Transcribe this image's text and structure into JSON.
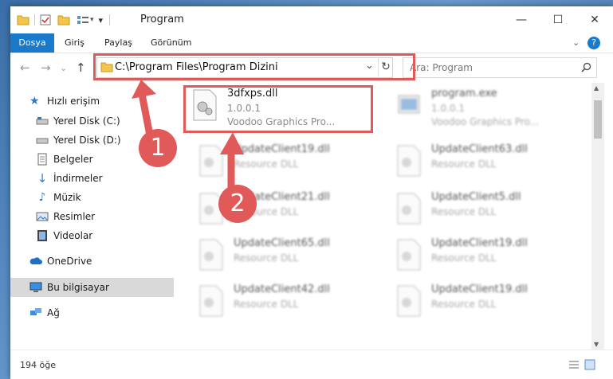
{
  "window": {
    "title": "Program",
    "minimize": "—",
    "maximize": "☐",
    "close": "✕"
  },
  "ribbon": {
    "tabs": [
      "Dosya",
      "Giriş",
      "Paylaş",
      "Görünüm"
    ],
    "expand": "⌄",
    "help": "?"
  },
  "nav": {
    "back": "←",
    "forward": "→",
    "recent": "⌄",
    "up": "↑",
    "address": "C:\\Program Files\\Program Dizini",
    "address_dropdown": "⌄",
    "refresh": "↻",
    "search_placeholder": "Ara: Program",
    "search_icon": "magnifier-icon"
  },
  "sidebar": {
    "items": [
      {
        "label": "Hızlı erişim",
        "icon": "star-icon",
        "pinned": false
      },
      {
        "label": "Yerel Disk (C:)",
        "icon": "drive-icon",
        "pinned": true
      },
      {
        "label": "Yerel Disk (D:)",
        "icon": "drive-icon",
        "pinned": true
      },
      {
        "label": "Belgeler",
        "icon": "documents-icon",
        "pinned": true
      },
      {
        "label": "İndirmeler",
        "icon": "download-icon",
        "pinned": true
      },
      {
        "label": "Müzik",
        "icon": "music-icon",
        "pinned": true
      },
      {
        "label": "Resimler",
        "icon": "pictures-icon",
        "pinned": true
      },
      {
        "label": "Videolar",
        "icon": "videos-icon",
        "pinned": true
      },
      {
        "label": "OneDrive",
        "icon": "cloud-icon",
        "pinned": false
      },
      {
        "label": "Bu bilgisayar",
        "icon": "computer-icon",
        "pinned": false,
        "selected": true
      },
      {
        "label": "Ağ",
        "icon": "network-icon",
        "pinned": false
      }
    ],
    "pin_glyph": "📌"
  },
  "files": [
    {
      "name": "3dfxps.dll",
      "line1": "1.0.0.1",
      "line2": "Voodoo Graphics Pro...",
      "type": "dll",
      "focused": true
    },
    {
      "name": "program.exe",
      "line1": "1.0.0.1",
      "line2": "Voodoo Graphics Pro...",
      "type": "exe"
    },
    {
      "name": "UpdateClient19.dll",
      "line1": "Resource DLL",
      "type": "dll"
    },
    {
      "name": "UpdateClient63.dll",
      "line1": "Resource DLL",
      "type": "dll"
    },
    {
      "name": "UpdateClient21.dll",
      "line1": "Resource DLL",
      "type": "dll"
    },
    {
      "name": "UpdateClient5.dll",
      "line1": "Resource DLL",
      "type": "dll"
    },
    {
      "name": "UpdateClient65.dll",
      "line1": "Resource DLL",
      "type": "dll"
    },
    {
      "name": "UpdateClient19.dll",
      "line1": "Resource DLL",
      "type": "dll"
    },
    {
      "name": "UpdateClient42.dll",
      "line1": "Resource DLL",
      "type": "dll"
    },
    {
      "name": "UpdateClient19.dll",
      "line1": "Resource DLL",
      "type": "dll"
    }
  ],
  "status": {
    "count": "194 öğe"
  },
  "annotations": {
    "badge1": "1",
    "badge2": "2",
    "highlight_color": "#e05a5a"
  }
}
